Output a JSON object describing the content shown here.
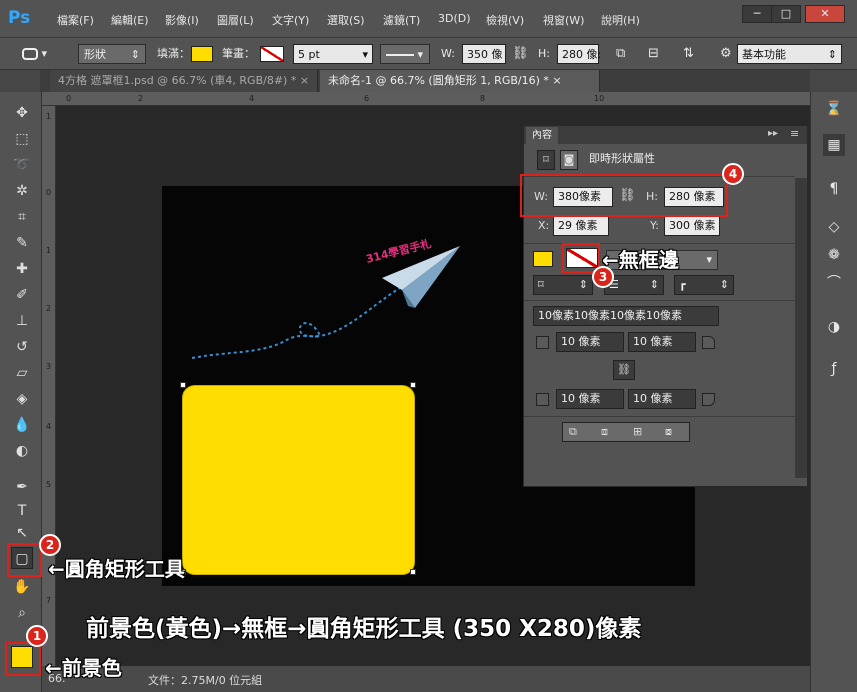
{
  "app": {
    "logo": "Ps"
  },
  "menu": [
    "檔案(F)",
    "編輯(E)",
    "影像(I)",
    "圖層(L)",
    "文字(Y)",
    "選取(S)",
    "濾鏡(T)",
    "3D(D)",
    "檢視(V)",
    "視窗(W)",
    "說明(H)"
  ],
  "window_buttons": {
    "minimize": "─",
    "restore": "□",
    "close": "✕"
  },
  "options": {
    "mode": "形狀",
    "fill_label": "填滿：",
    "fill_color": "#ffdd00",
    "stroke_label": "筆畫：",
    "stroke_width": "5 pt",
    "w_label": "W:",
    "w_value": "350 像",
    "h_label": "H:",
    "h_value": "280 像:",
    "workspace": "基本功能"
  },
  "tabs": [
    "4方格 遮罩框1.psd @ 66.7% (車4, RGB/8#) *",
    "未命名-1 @ 66.7% (圓角矩形 1, RGB/16) *"
  ],
  "ruler": {
    "top": [
      "0",
      "2",
      "4",
      "6",
      "8",
      "10"
    ],
    "left": [
      "1",
      "0",
      "1",
      "2",
      "3",
      "4",
      "5",
      "6",
      "7"
    ]
  },
  "canvas": {
    "logo_text": "314學習手札",
    "shape_color": "#ffdd00"
  },
  "properties": {
    "tab": "內容",
    "title": "即時形狀屬性",
    "w_label": "W:",
    "w_value": "380像素",
    "h_label": "H:",
    "h_value": "280 像素",
    "x_label": "X:",
    "x_value": "29 像素",
    "y_label": "Y:",
    "y_value": "300 像素",
    "corner_summary": "10像素10像素10像素10像素",
    "corners": [
      "10 像素",
      "10 像素",
      "10 像素",
      "10 像素"
    ]
  },
  "status": {
    "zoom": "66.",
    "doc": "文件：2.75M/0 位元組"
  },
  "annotations": {
    "b1": "1",
    "b2": "2",
    "b3": "3",
    "b4": "4",
    "no_stroke": "←無框邊",
    "rounded_rect_tool": "←圓角矩形工具",
    "foreground": "←前景色",
    "caption": "前景色(黃色)→無框→圓角矩形工具 (350 X280)像素"
  }
}
